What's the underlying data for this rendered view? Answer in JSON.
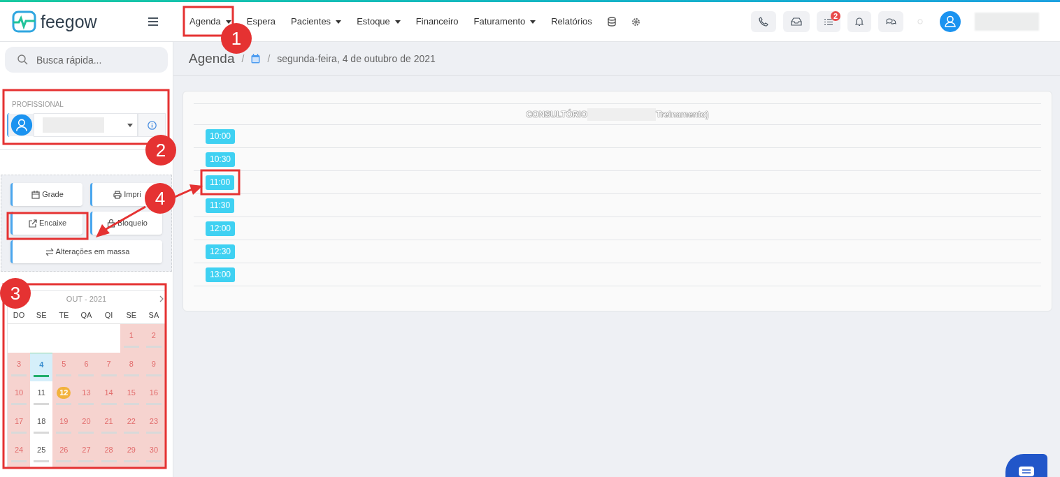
{
  "topbar": {
    "brand": "feegow",
    "nav": [
      {
        "label": "Agenda",
        "dropdown": true
      },
      {
        "label": "Espera",
        "dropdown": false
      },
      {
        "label": "Pacientes",
        "dropdown": true
      },
      {
        "label": "Estoque",
        "dropdown": true
      },
      {
        "label": "Financeiro",
        "dropdown": false
      },
      {
        "label": "Faturamento",
        "dropdown": true
      },
      {
        "label": "Relatórios",
        "dropdown": false
      }
    ],
    "tasks_badge": "2"
  },
  "sidebar": {
    "search": {
      "placeholder": "Busca rápida..."
    },
    "professional_label": "PROFISSIONAL",
    "actions": [
      {
        "label": "Grade",
        "wide": false
      },
      {
        "label": "Impri",
        "wide": false
      },
      {
        "label": "Encaixe",
        "wide": false
      },
      {
        "label": "Bloqueio",
        "wide": false
      },
      {
        "label": "Alterações em massa",
        "wide": true
      }
    ],
    "calendar": {
      "title": "OUT - 2021",
      "weekdays": [
        "DO",
        "SE",
        "TE",
        "QA",
        "QI",
        "SE",
        "SA"
      ],
      "days": [
        {
          "day": "1",
          "blocked": true,
          "selected": false,
          "today": false
        },
        {
          "day": "2",
          "blocked": true,
          "selected": false,
          "today": false
        },
        {
          "day": "3",
          "blocked": true,
          "selected": false,
          "today": false
        },
        {
          "day": "4",
          "blocked": false,
          "selected": true,
          "today": false
        },
        {
          "day": "5",
          "blocked": true,
          "selected": false,
          "today": false
        },
        {
          "day": "6",
          "blocked": true,
          "selected": false,
          "today": false
        },
        {
          "day": "7",
          "blocked": true,
          "selected": false,
          "today": false
        },
        {
          "day": "8",
          "blocked": true,
          "selected": false,
          "today": false
        },
        {
          "day": "9",
          "blocked": true,
          "selected": false,
          "today": false
        },
        {
          "day": "10",
          "blocked": true,
          "selected": false,
          "today": false
        },
        {
          "day": "11",
          "blocked": false,
          "selected": false,
          "today": false
        },
        {
          "day": "12",
          "blocked": true,
          "selected": false,
          "today": true
        },
        {
          "day": "13",
          "blocked": true,
          "selected": false,
          "today": false
        },
        {
          "day": "14",
          "blocked": true,
          "selected": false,
          "today": false
        },
        {
          "day": "15",
          "blocked": true,
          "selected": false,
          "today": false
        },
        {
          "day": "16",
          "blocked": true,
          "selected": false,
          "today": false
        },
        {
          "day": "17",
          "blocked": true,
          "selected": false,
          "today": false
        },
        {
          "day": "18",
          "blocked": false,
          "selected": false,
          "today": false
        },
        {
          "day": "19",
          "blocked": true,
          "selected": false,
          "today": false
        },
        {
          "day": "20",
          "blocked": true,
          "selected": false,
          "today": false
        },
        {
          "day": "21",
          "blocked": true,
          "selected": false,
          "today": false
        },
        {
          "day": "22",
          "blocked": true,
          "selected": false,
          "today": false
        },
        {
          "day": "23",
          "blocked": true,
          "selected": false,
          "today": false
        },
        {
          "day": "24",
          "blocked": true,
          "selected": false,
          "today": false
        },
        {
          "day": "25",
          "blocked": false,
          "selected": false,
          "today": false
        },
        {
          "day": "26",
          "blocked": true,
          "selected": false,
          "today": false
        },
        {
          "day": "27",
          "blocked": true,
          "selected": false,
          "today": false
        },
        {
          "day": "28",
          "blocked": true,
          "selected": false,
          "today": false
        },
        {
          "day": "29",
          "blocked": true,
          "selected": false,
          "today": false
        },
        {
          "day": "30",
          "blocked": true,
          "selected": false,
          "today": false
        }
      ]
    }
  },
  "breadcrumb": {
    "title": "Agenda",
    "separators": [
      "/",
      "/"
    ],
    "date": "segunda-feira, 4 de outubro de 2021"
  },
  "schedule": {
    "room_prefix": "CONSULTÓRIO",
    "room_suffix": "Treinamento)",
    "slots": [
      "10:00",
      "10:30",
      "11:00",
      "11:30",
      "12:00",
      "12:30",
      "13:00"
    ]
  },
  "annotations": [
    "1",
    "2",
    "3",
    "4"
  ]
}
